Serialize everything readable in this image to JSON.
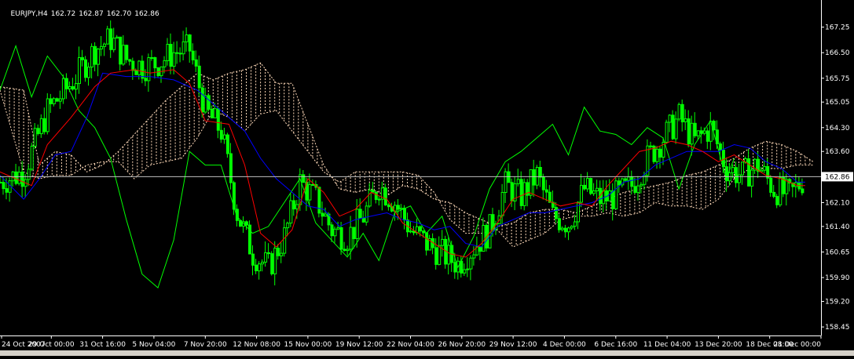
{
  "header": {
    "symbol_timeframe": "EURJPY,H4",
    "open": "162.72",
    "high": "162.87",
    "low": "162.70",
    "close": "162.86"
  },
  "current_price_label": "162.86",
  "colors": {
    "background": "#000000",
    "candles": "#00ff00",
    "tenkan_sen": "#ff0000",
    "kijun_sen": "#0000ff",
    "chikou_span": "#00ff00",
    "kumo": "#ffdab9",
    "price_line": "#c0c0c0",
    "text": "#ffffff"
  },
  "chart_data": {
    "type": "candlestick",
    "indicator": "Ichimoku",
    "ylim": [
      158.2,
      167.7
    ],
    "y_ticks": [
      "167.25",
      "166.50",
      "165.75",
      "165.05",
      "164.30",
      "163.60",
      "162.10",
      "161.40",
      "160.65",
      "159.90",
      "159.20",
      "158.45"
    ],
    "y_tick_values": [
      167.25,
      166.5,
      165.75,
      165.05,
      164.3,
      163.6,
      162.1,
      161.4,
      160.65,
      159.9,
      159.2,
      158.45
    ],
    "x_ticks": [
      "24 Oct 2007",
      "29 Oct 00:00",
      "31 Oct 16:00",
      "5 Nov 04:00",
      "7 Nov 20:00",
      "12 Nov 08:00",
      "15 Nov 00:00",
      "19 Nov 12:00",
      "22 Nov 04:00",
      "26 Nov 20:00",
      "29 Nov 12:00",
      "4 Dec 00:00",
      "6 Dec 16:00",
      "11 Dec 04:00",
      "13 Dec 20:00",
      "18 Dec 08:00",
      "21 Dec 00:00"
    ],
    "current_price": 162.86,
    "close_path": [
      [
        0,
        162.7
      ],
      [
        3,
        163.0
      ],
      [
        6,
        164.8
      ],
      [
        9,
        165.6
      ],
      [
        12,
        166.6
      ],
      [
        14,
        166.9
      ],
      [
        16,
        166.3
      ],
      [
        18,
        166.1
      ],
      [
        20,
        166.2
      ],
      [
        22,
        166.5
      ],
      [
        24,
        166.6
      ],
      [
        26,
        164.8
      ],
      [
        28,
        164.2
      ],
      [
        30,
        161.8
      ],
      [
        32,
        160.6
      ],
      [
        34,
        160.2
      ],
      [
        36,
        161.1
      ],
      [
        38,
        162.7
      ],
      [
        40,
        162.2
      ],
      [
        42,
        161.3
      ],
      [
        44,
        161.1
      ],
      [
        46,
        161.7
      ],
      [
        48,
        162.6
      ],
      [
        50,
        162.1
      ],
      [
        52,
        161.3
      ],
      [
        54,
        160.9
      ],
      [
        56,
        160.6
      ],
      [
        58,
        160.3
      ],
      [
        60,
        160.8
      ],
      [
        62,
        161.3
      ],
      [
        64,
        162.6
      ],
      [
        66,
        162.3
      ],
      [
        68,
        162.9
      ],
      [
        70,
        161.7
      ],
      [
        72,
        161.5
      ],
      [
        74,
        162.5
      ],
      [
        76,
        162.2
      ],
      [
        78,
        162.3
      ],
      [
        80,
        162.6
      ],
      [
        82,
        163.4
      ],
      [
        84,
        164.0
      ],
      [
        86,
        164.6
      ],
      [
        88,
        163.9
      ],
      [
        90,
        164.3
      ],
      [
        92,
        163.1
      ],
      [
        94,
        162.9
      ],
      [
        96,
        163.2
      ],
      [
        98,
        162.5
      ],
      [
        100,
        162.3
      ],
      [
        102,
        162.86
      ]
    ],
    "tenkan_sen": [
      [
        0,
        163.0
      ],
      [
        4,
        162.6
      ],
      [
        6,
        163.8
      ],
      [
        9,
        164.6
      ],
      [
        12,
        165.5
      ],
      [
        14,
        165.9
      ],
      [
        17,
        166.0
      ],
      [
        19,
        165.9
      ],
      [
        22,
        166.0
      ],
      [
        24,
        165.6
      ],
      [
        26,
        164.5
      ],
      [
        29,
        164.4
      ],
      [
        31,
        163.2
      ],
      [
        33,
        161.2
      ],
      [
        35,
        160.8
      ],
      [
        37,
        161.3
      ],
      [
        39,
        162.8
      ],
      [
        41,
        162.4
      ],
      [
        43,
        161.7
      ],
      [
        45,
        161.9
      ],
      [
        47,
        162.4
      ],
      [
        49,
        162.2
      ],
      [
        51,
        161.5
      ],
      [
        53,
        161.2
      ],
      [
        55,
        160.9
      ],
      [
        57,
        160.6
      ],
      [
        59,
        160.5
      ],
      [
        61,
        160.9
      ],
      [
        63,
        161.5
      ],
      [
        65,
        162.2
      ],
      [
        67,
        162.4
      ],
      [
        69,
        162.2
      ],
      [
        71,
        162.0
      ],
      [
        73,
        162.1
      ],
      [
        75,
        162.0
      ],
      [
        77,
        162.6
      ],
      [
        79,
        163.1
      ],
      [
        81,
        163.6
      ],
      [
        83,
        163.7
      ],
      [
        85,
        163.9
      ],
      [
        87,
        163.8
      ],
      [
        89,
        163.6
      ],
      [
        91,
        163.3
      ],
      [
        93,
        163.5
      ],
      [
        95,
        163.2
      ],
      [
        97,
        162.9
      ],
      [
        99,
        162.8
      ],
      [
        101,
        162.6
      ],
      [
        102,
        162.6
      ]
    ],
    "kijun_sen": [
      [
        0,
        162.9
      ],
      [
        3,
        162.2
      ],
      [
        5,
        162.8
      ],
      [
        7,
        163.5
      ],
      [
        9,
        163.6
      ],
      [
        11,
        164.6
      ],
      [
        13,
        165.9
      ],
      [
        16,
        165.8
      ],
      [
        19,
        165.8
      ],
      [
        22,
        165.7
      ],
      [
        25,
        165.4
      ],
      [
        28,
        164.8
      ],
      [
        31,
        164.2
      ],
      [
        33,
        163.4
      ],
      [
        35,
        162.8
      ],
      [
        37,
        162.4
      ],
      [
        39,
        162.0
      ],
      [
        41,
        161.9
      ],
      [
        43,
        161.4
      ],
      [
        45,
        161.6
      ],
      [
        47,
        161.7
      ],
      [
        49,
        161.8
      ],
      [
        51,
        161.6
      ],
      [
        53,
        161.5
      ],
      [
        55,
        161.3
      ],
      [
        57,
        161.4
      ],
      [
        59,
        160.9
      ],
      [
        61,
        160.8
      ],
      [
        63,
        161.4
      ],
      [
        65,
        161.6
      ],
      [
        67,
        161.8
      ],
      [
        69,
        161.8
      ],
      [
        71,
        161.9
      ],
      [
        73,
        162.0
      ],
      [
        75,
        162.1
      ],
      [
        77,
        162.3
      ],
      [
        79,
        162.7
      ],
      [
        81,
        162.8
      ],
      [
        83,
        163.2
      ],
      [
        85,
        163.4
      ],
      [
        87,
        163.6
      ],
      [
        89,
        163.6
      ],
      [
        91,
        163.6
      ],
      [
        93,
        163.8
      ],
      [
        95,
        163.7
      ],
      [
        97,
        163.3
      ],
      [
        99,
        163.1
      ],
      [
        101,
        162.7
      ],
      [
        102,
        162.7
      ]
    ],
    "chikou_span": [
      [
        0,
        165.4
      ],
      [
        2,
        166.7
      ],
      [
        4,
        165.2
      ],
      [
        6,
        166.4
      ],
      [
        8,
        165.8
      ],
      [
        10,
        164.8
      ],
      [
        12,
        164.3
      ],
      [
        14,
        163.4
      ],
      [
        16,
        161.6
      ],
      [
        18,
        160.0
      ],
      [
        20,
        159.6
      ],
      [
        22,
        161.0
      ],
      [
        24,
        163.6
      ],
      [
        26,
        163.2
      ],
      [
        28,
        163.2
      ],
      [
        30,
        161.7
      ],
      [
        32,
        161.2
      ],
      [
        34,
        161.4
      ],
      [
        36,
        162.1
      ],
      [
        38,
        162.8
      ],
      [
        40,
        161.5
      ],
      [
        42,
        161.0
      ],
      [
        44,
        160.5
      ],
      [
        46,
        161.2
      ],
      [
        48,
        160.4
      ],
      [
        50,
        161.8
      ],
      [
        52,
        162.0
      ],
      [
        54,
        161.2
      ],
      [
        56,
        161.7
      ],
      [
        58,
        160.2
      ],
      [
        60,
        161.1
      ],
      [
        62,
        162.5
      ],
      [
        64,
        163.3
      ],
      [
        66,
        163.6
      ],
      [
        68,
        164.0
      ],
      [
        70,
        164.4
      ],
      [
        72,
        163.5
      ],
      [
        74,
        164.9
      ],
      [
        76,
        164.2
      ],
      [
        78,
        164.1
      ],
      [
        80,
        163.8
      ],
      [
        82,
        164.3
      ],
      [
        84,
        164.0
      ],
      [
        86,
        162.5
      ],
      [
        88,
        163.8
      ],
      [
        90,
        164.5
      ],
      [
        92,
        162.8
      ],
      [
        93,
        163.4
      ]
    ],
    "senkou_a": [
      [
        0,
        165.5
      ],
      [
        3,
        165.4
      ],
      [
        5,
        163.2
      ],
      [
        7,
        163.6
      ],
      [
        9,
        163.5
      ],
      [
        11,
        163.0
      ],
      [
        13,
        163.2
      ],
      [
        15,
        163.6
      ],
      [
        17,
        164.1
      ],
      [
        19,
        164.6
      ],
      [
        21,
        165.1
      ],
      [
        23,
        165.5
      ],
      [
        25,
        165.9
      ],
      [
        27,
        165.7
      ],
      [
        29,
        165.9
      ],
      [
        31,
        166.0
      ],
      [
        33,
        166.2
      ],
      [
        35,
        165.6
      ],
      [
        37,
        165.6
      ],
      [
        39,
        164.4
      ],
      [
        41,
        163.2
      ],
      [
        43,
        162.5
      ],
      [
        45,
        162.4
      ],
      [
        47,
        162.5
      ],
      [
        49,
        162.3
      ],
      [
        51,
        162.6
      ],
      [
        53,
        162.5
      ],
      [
        55,
        162.2
      ],
      [
        57,
        162.1
      ],
      [
        59,
        161.8
      ],
      [
        61,
        161.6
      ],
      [
        63,
        161.4
      ],
      [
        65,
        161.5
      ],
      [
        67,
        161.8
      ],
      [
        69,
        161.9
      ],
      [
        71,
        161.9
      ],
      [
        73,
        161.8
      ],
      [
        75,
        162.0
      ],
      [
        77,
        162.2
      ],
      [
        79,
        162.4
      ],
      [
        81,
        162.5
      ],
      [
        83,
        162.6
      ],
      [
        85,
        162.7
      ],
      [
        87,
        162.9
      ],
      [
        89,
        163.0
      ],
      [
        91,
        163.2
      ],
      [
        93,
        163.4
      ],
      [
        95,
        163.7
      ],
      [
        97,
        163.9
      ],
      [
        99,
        163.8
      ],
      [
        101,
        163.6
      ],
      [
        103,
        163.3
      ]
    ],
    "senkou_b": [
      [
        0,
        165.4
      ],
      [
        3,
        163.0
      ],
      [
        5,
        162.8
      ],
      [
        7,
        162.9
      ],
      [
        9,
        162.9
      ],
      [
        11,
        163.2
      ],
      [
        13,
        163.3
      ],
      [
        15,
        163.3
      ],
      [
        17,
        162.8
      ],
      [
        19,
        163.2
      ],
      [
        21,
        163.3
      ],
      [
        23,
        163.4
      ],
      [
        25,
        164.0
      ],
      [
        27,
        164.8
      ],
      [
        29,
        164.6
      ],
      [
        31,
        164.2
      ],
      [
        33,
        164.7
      ],
      [
        35,
        164.8
      ],
      [
        37,
        164.2
      ],
      [
        39,
        163.6
      ],
      [
        41,
        163.0
      ],
      [
        43,
        162.7
      ],
      [
        45,
        163.0
      ],
      [
        47,
        163.0
      ],
      [
        49,
        163.0
      ],
      [
        51,
        163.0
      ],
      [
        53,
        162.9
      ],
      [
        55,
        162.4
      ],
      [
        57,
        161.6
      ],
      [
        59,
        161.2
      ],
      [
        61,
        161.2
      ],
      [
        63,
        161.3
      ],
      [
        65,
        160.8
      ],
      [
        67,
        161.0
      ],
      [
        69,
        161.2
      ],
      [
        71,
        161.6
      ],
      [
        73,
        161.7
      ],
      [
        75,
        161.7
      ],
      [
        77,
        161.8
      ],
      [
        79,
        161.7
      ],
      [
        81,
        161.8
      ],
      [
        83,
        162.1
      ],
      [
        85,
        162.0
      ],
      [
        87,
        162.0
      ],
      [
        89,
        161.9
      ],
      [
        91,
        162.2
      ],
      [
        93,
        162.8
      ],
      [
        95,
        163.1
      ],
      [
        97,
        163.1
      ],
      [
        99,
        163.1
      ],
      [
        101,
        163.2
      ],
      [
        103,
        163.2
      ]
    ],
    "x_range": [
      0,
      104
    ]
  }
}
